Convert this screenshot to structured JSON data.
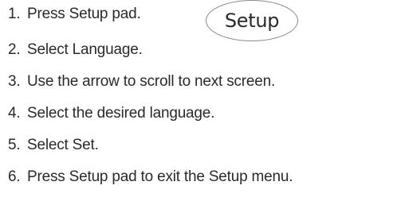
{
  "steps": [
    {
      "number": "1.",
      "text": "Press Setup pad."
    },
    {
      "number": "2.",
      "text": "Select Language."
    },
    {
      "number": "3.",
      "text": "Use the arrow to scroll to next screen."
    },
    {
      "number": "4.",
      "text": "Select the desired language."
    },
    {
      "number": "5.",
      "text": "Select Set."
    },
    {
      "number": "6.",
      "text": "Press Setup pad to exit the Setup menu."
    }
  ],
  "setup_pad": {
    "label": "Setup"
  }
}
